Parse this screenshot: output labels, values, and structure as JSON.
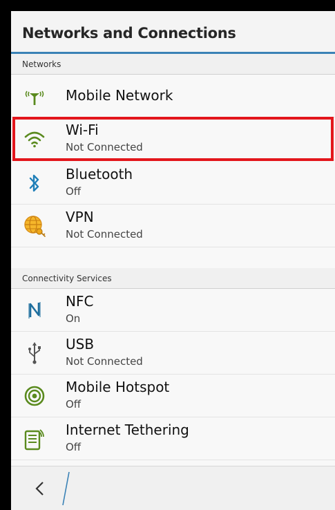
{
  "header": {
    "title": "Networks and Connections"
  },
  "sections": [
    {
      "title": "Networks",
      "items": [
        {
          "icon": "antenna-icon",
          "label": "Mobile Network",
          "status": ""
        },
        {
          "icon": "wifi-icon",
          "label": "Wi-Fi",
          "status": "Not Connected"
        },
        {
          "icon": "bluetooth-icon",
          "label": "Bluetooth",
          "status": "Off"
        },
        {
          "icon": "vpn-globe-icon",
          "label": "VPN",
          "status": "Not Connected"
        }
      ]
    },
    {
      "title": "Connectivity Services",
      "items": [
        {
          "icon": "nfc-icon",
          "label": "NFC",
          "status": "On"
        },
        {
          "icon": "usb-icon",
          "label": "USB",
          "status": "Not Connected"
        },
        {
          "icon": "hotspot-icon",
          "label": "Mobile Hotspot",
          "status": "Off"
        },
        {
          "icon": "tethering-icon",
          "label": "Internet Tethering",
          "status": "Off"
        }
      ]
    }
  ],
  "footer": {
    "back_icon": "back-chevron-icon"
  },
  "colors": {
    "accent_line": "#3a82b6",
    "highlight_box": "#e3161c",
    "icon_green": "#5a8a1e",
    "icon_blue": "#1f7fb8",
    "vpn_globe": "#f0a81a"
  }
}
